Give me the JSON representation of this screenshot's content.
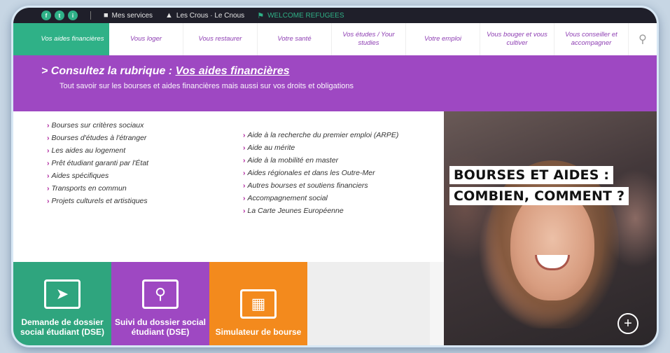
{
  "topbar": {
    "social": [
      "f",
      "t",
      "i"
    ],
    "links": [
      {
        "icon": "services-icon",
        "label": "Mes services"
      },
      {
        "icon": "crous-icon",
        "label": "Les Crous · Le Cnous"
      },
      {
        "icon": "welcome-icon",
        "label": "WELCOME REFUGEES"
      }
    ]
  },
  "nav": {
    "items": [
      {
        "label": "Vos aides financières"
      },
      {
        "label": "Vous loger"
      },
      {
        "label": "Vous restaurer"
      },
      {
        "label": "Votre santé"
      },
      {
        "label": "Vos études / Your studies"
      },
      {
        "label": "Votre emploi"
      },
      {
        "label": "Vous bouger et vous cultiver"
      },
      {
        "label": "Vous conseiller et accompagner"
      }
    ]
  },
  "banner": {
    "prefix": "> Consultez la rubrique : ",
    "link": "Vos aides financières",
    "subtitle": "Tout savoir sur les bourses et aides financières mais aussi sur vos droits et obligations"
  },
  "links": {
    "left": [
      "Bourses sur critères sociaux",
      "Bourses d'études à l'étranger",
      "Les aides au logement",
      "Prêt étudiant garanti par l'État",
      "Aides spécifiques",
      "Transports en commun",
      "Projets culturels et artistiques"
    ],
    "right": [
      "Aide à la recherche du premier emploi (ARPE)",
      "Aide au mérite",
      "Aide à la mobilité en master",
      "Aides régionales et dans les Outre-Mer",
      "Autres bourses et soutiens financiers",
      "Accompagnement social",
      "La Carte Jeunes Européenne"
    ]
  },
  "promo": {
    "line1": "BOURSES ET AIDES :",
    "line2": "COMBIEN, COMMENT ?"
  },
  "tiles": {
    "dse_request": "Demande de dossier social étudiant (DSE)",
    "dse_follow": "Suivi du dossier social étudiant (DSE)",
    "simulator": "Simulateur de bourse"
  },
  "colors": {
    "green": "#2fb187",
    "purple": "#9e48c2",
    "orange": "#f38a1d"
  }
}
